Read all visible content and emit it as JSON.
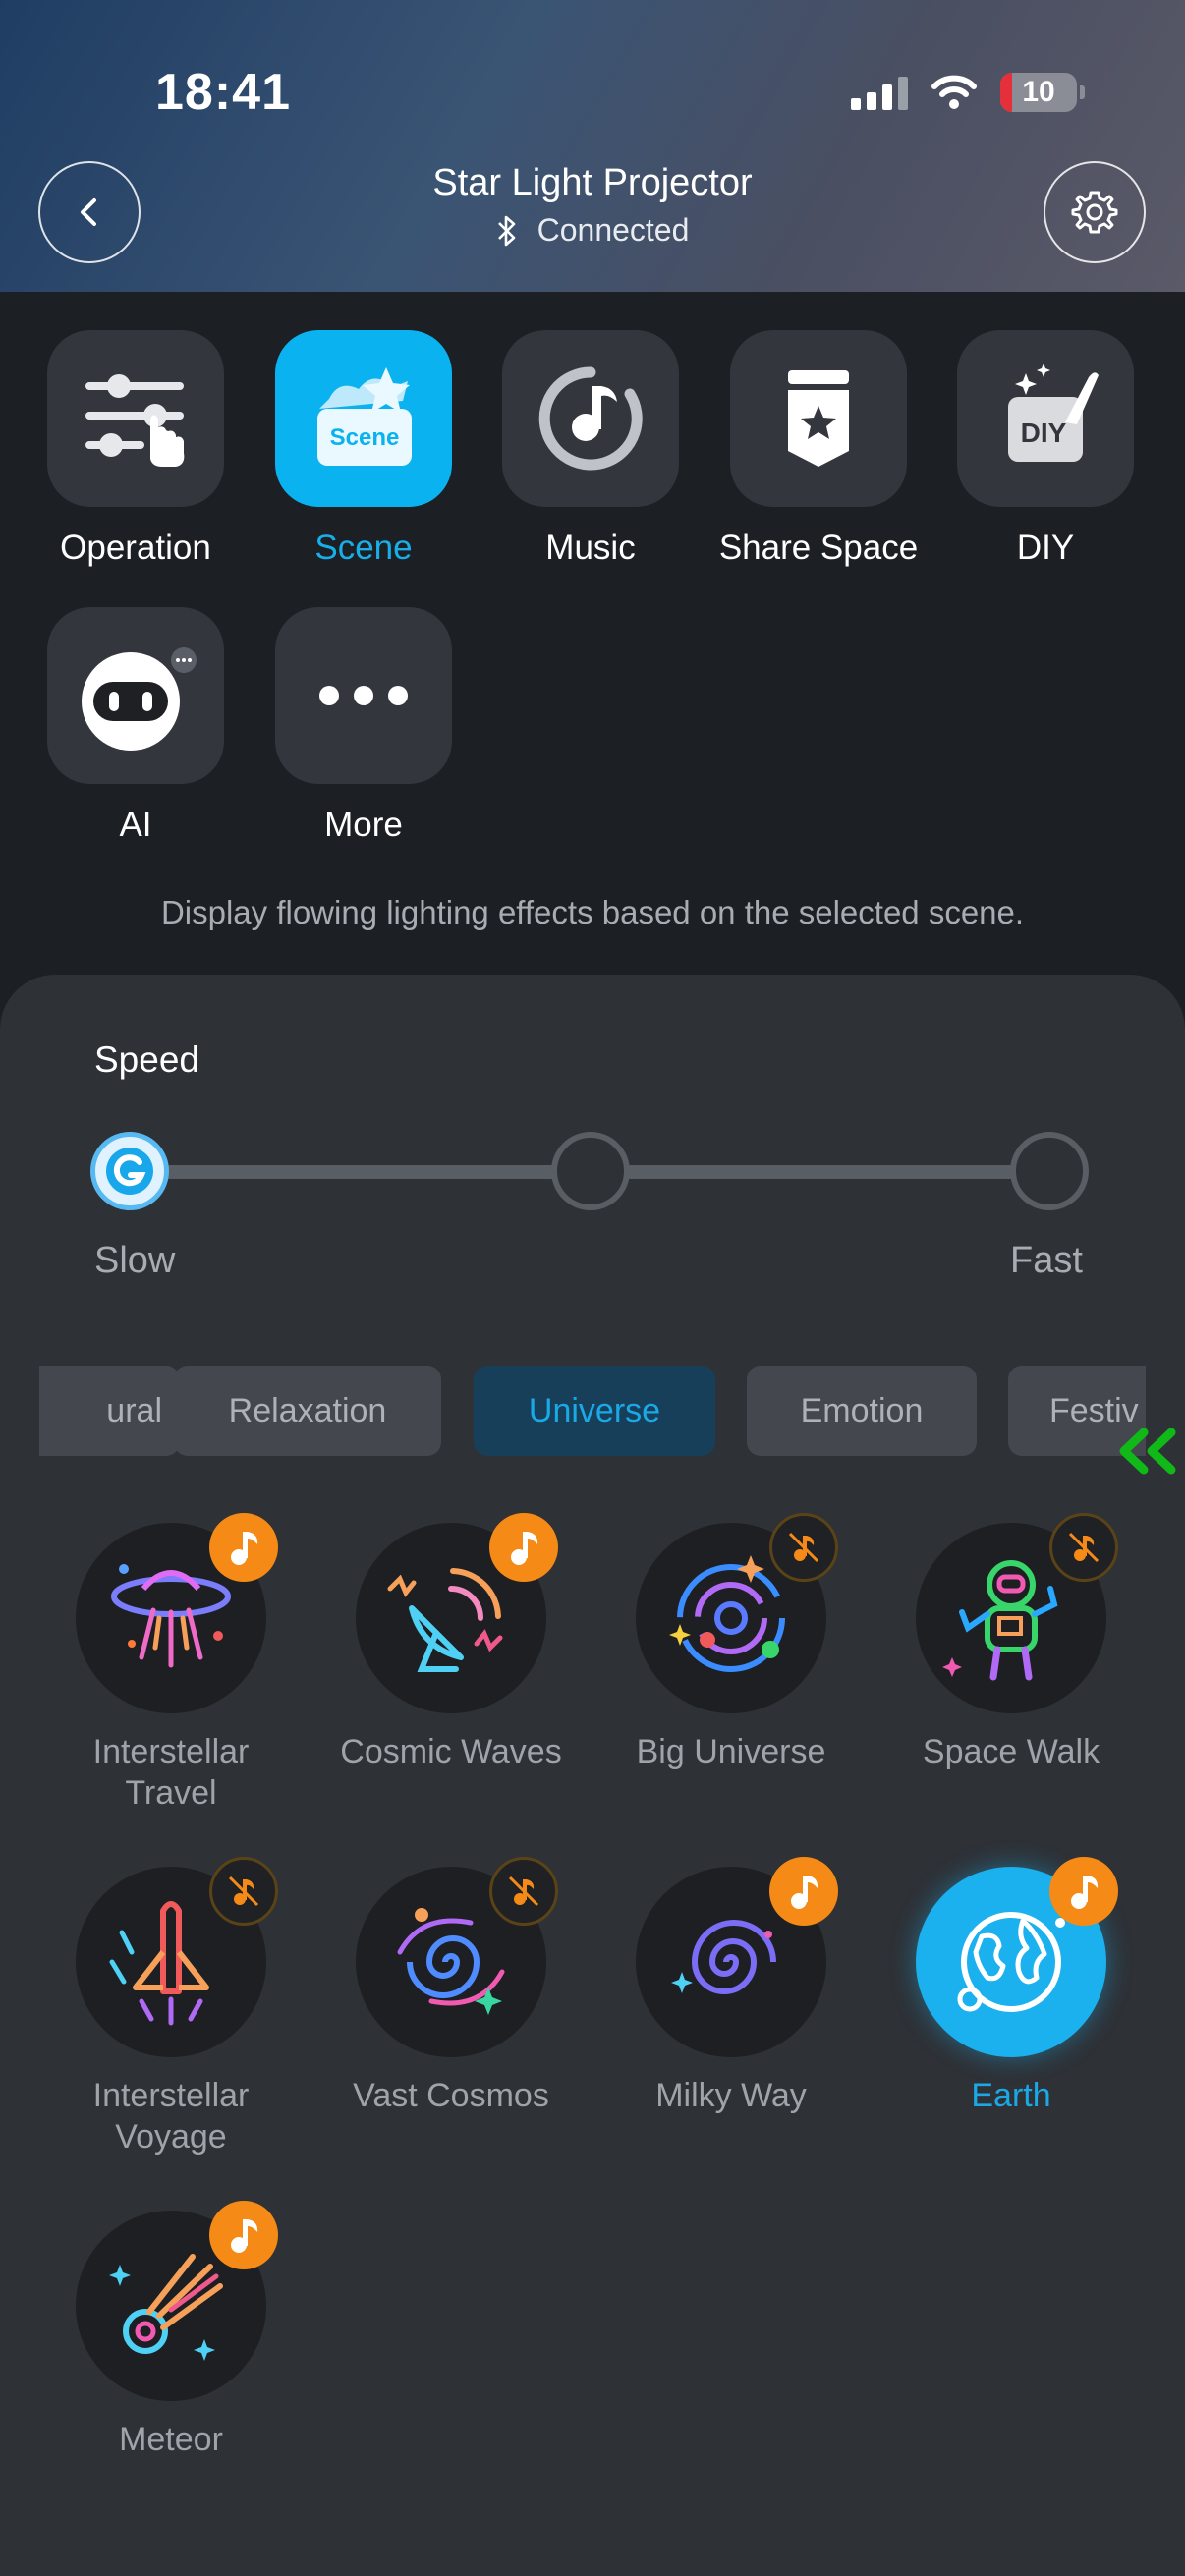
{
  "status_bar": {
    "time": "18:41",
    "battery": "10"
  },
  "header": {
    "title": "Star Light Projector",
    "status": "Connected"
  },
  "features": [
    {
      "label": "Operation"
    },
    {
      "label": "Scene"
    },
    {
      "label": "Music"
    },
    {
      "label": "Share Space"
    },
    {
      "label": "DIY"
    },
    {
      "label": "AI"
    },
    {
      "label": "More"
    }
  ],
  "scene_tile_text": "Scene",
  "diy_tile_text": "DIY",
  "description": "Display flowing lighting effects based on the selected scene.",
  "speed": {
    "label": "Speed",
    "min_label": "Slow",
    "max_label": "Fast",
    "selected_step": 1,
    "steps": 3
  },
  "tabs": [
    {
      "label": "ural"
    },
    {
      "label": "Relaxation"
    },
    {
      "label": "Universe"
    },
    {
      "label": "Emotion"
    },
    {
      "label": "Festiv"
    }
  ],
  "active_tab": "Universe",
  "scenes": [
    {
      "name": "Interstellar Travel",
      "music": true
    },
    {
      "name": "Cosmic Waves",
      "music": true
    },
    {
      "name": "Big Universe",
      "music": false
    },
    {
      "name": "Space Walk",
      "music": false
    },
    {
      "name": "Interstellar Voyage",
      "music": false
    },
    {
      "name": "Vast Cosmos",
      "music": false
    },
    {
      "name": "Milky Way",
      "music": true
    },
    {
      "name": "Earth",
      "music": true,
      "selected": true
    },
    {
      "name": "Meteor",
      "music": true
    }
  ],
  "colors": {
    "accent": "#1aa9e6",
    "music_badge": "#f58a16",
    "background": "#1c1f24",
    "panel": "#2e3136"
  }
}
